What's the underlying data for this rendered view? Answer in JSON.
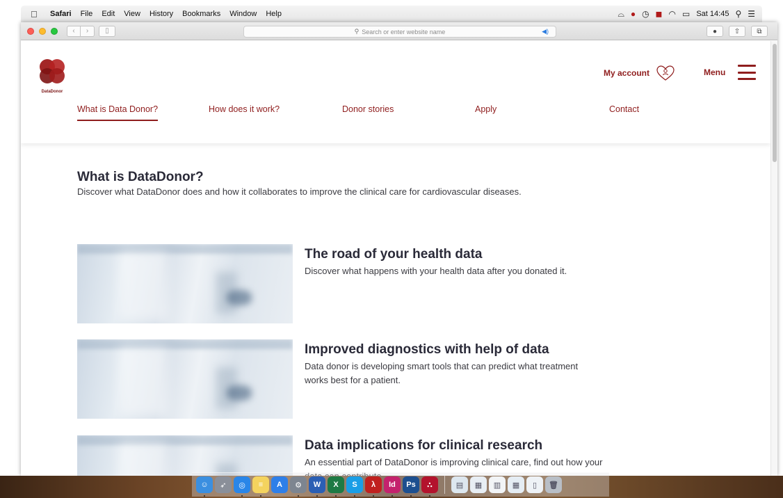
{
  "menubar": {
    "app_name": "Safari",
    "items": [
      "File",
      "Edit",
      "View",
      "History",
      "Bookmarks",
      "Window",
      "Help"
    ],
    "clock": "Sat 14:45"
  },
  "browser": {
    "search_placeholder": "Search or enter website name"
  },
  "site": {
    "logo_text": "DataDonor",
    "account_label": "My account",
    "menu_label": "Menu",
    "nav": [
      {
        "label": "What is Data Donor?",
        "active": true
      },
      {
        "label": "How does it work?"
      },
      {
        "label": "Donor stories"
      },
      {
        "label": "Apply"
      },
      {
        "label": "Contact"
      }
    ],
    "brand_color": "#8f1d1d"
  },
  "page": {
    "title": "What is DataDonor?",
    "intro": "Discover what DataDonor does and how it collaborates to improve the clinical care for cardiovascular diseases.",
    "cards": [
      {
        "title": "The road of your health data",
        "desc": "Discover what happens with your health data after you donated it."
      },
      {
        "title": "Improved diagnostics with help of data",
        "desc": "Data donor is developing smart tools that can predict what treatment works best for a patient."
      },
      {
        "title": "Data implications for clinical research",
        "desc": "An essential part of DataDonor is improving clinical care, find out how your data can contribute."
      }
    ]
  },
  "dock": {
    "apps": [
      {
        "name": "finder-icon",
        "color": "#3b8fe0",
        "glyph": "☺"
      },
      {
        "name": "launchpad-icon",
        "color": "#8a8f99",
        "glyph": "➶"
      },
      {
        "name": "safari-icon",
        "color": "#2a86e8",
        "glyph": "◎"
      },
      {
        "name": "notes-icon",
        "color": "#f4d35e",
        "glyph": "≡"
      },
      {
        "name": "app-store-icon",
        "color": "#2f7fe8",
        "glyph": "A"
      },
      {
        "name": "system-preferences-icon",
        "color": "#7d8590",
        "glyph": "⚙"
      },
      {
        "name": "word-icon",
        "color": "#2b5fb4",
        "glyph": "W"
      },
      {
        "name": "excel-icon",
        "color": "#1e7a44",
        "glyph": "X"
      },
      {
        "name": "skype-icon",
        "color": "#1a9ee6",
        "glyph": "S"
      },
      {
        "name": "acrobat-icon",
        "color": "#c0201e",
        "glyph": "λ"
      },
      {
        "name": "indesign-icon",
        "color": "#c4226d",
        "glyph": "Id"
      },
      {
        "name": "photoshop-icon",
        "color": "#1d4f8f",
        "glyph": "Ps"
      },
      {
        "name": "mendeley-icon",
        "color": "#b3132d",
        "glyph": "∴"
      }
    ],
    "files": [
      {
        "name": "preview-icon",
        "color": "#dde7ef",
        "glyph": "▤"
      },
      {
        "name": "document-icon",
        "color": "#e8eef4",
        "glyph": "▦"
      },
      {
        "name": "document-icon",
        "color": "#f2f4f6",
        "glyph": "▥"
      },
      {
        "name": "document-icon",
        "color": "#e5edf4",
        "glyph": "▦"
      },
      {
        "name": "document-icon",
        "color": "#eef2f6",
        "glyph": "▯"
      },
      {
        "name": "trash-icon",
        "color": "#b8bec6",
        "glyph": "🗑"
      }
    ]
  }
}
